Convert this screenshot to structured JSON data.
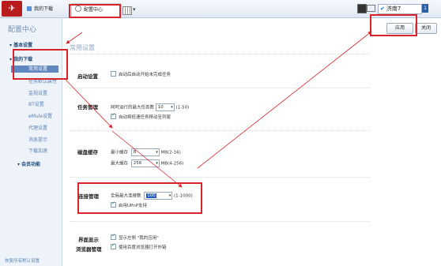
{
  "topbar": {
    "tabs": [
      {
        "label": "我的下载"
      },
      {
        "label": "配置中心"
      }
    ],
    "user": {
      "name": "济南7",
      "badge": "1"
    }
  },
  "sidebar": {
    "title": "配置中心",
    "items": [
      {
        "label": "基本设置",
        "kind": "header"
      },
      {
        "label": "我的下载",
        "kind": "header"
      },
      {
        "label": "常用设置",
        "kind": "sub",
        "selected": true
      },
      {
        "label": "任务默认属性",
        "kind": "sub"
      },
      {
        "label": "监视设置",
        "kind": "sub"
      },
      {
        "label": "BT设置",
        "kind": "sub"
      },
      {
        "label": "eMule设置",
        "kind": "sub"
      },
      {
        "label": "代理设置",
        "kind": "sub"
      },
      {
        "label": "消息提示",
        "kind": "sub"
      },
      {
        "label": "下载加速",
        "kind": "sub"
      },
      {
        "label": "会员功能",
        "kind": "header"
      }
    ],
    "restore": "恢复所有默认设置"
  },
  "toolbar": {
    "apply_label": "应用",
    "close_label": "关闭"
  },
  "main": {
    "section_title": "常用设置",
    "startup": {
      "label": "启动设置",
      "option": "启动后自动开始未完成任务",
      "checked": false
    },
    "task": {
      "label": "任务管理",
      "max_tasks_label": "同时运行的最大任务数",
      "max_tasks_value": "10",
      "max_tasks_range": "(1-50)",
      "auto_move_label": "自动将低速任务移动至列尾",
      "auto_move_checked": true
    },
    "cache": {
      "label": "磁盘缓存",
      "min_label": "最小缓存",
      "min_value": "8",
      "min_unit": "MB(2-16)",
      "max_label": "最大缓存",
      "max_value": "256",
      "max_unit": "MB(4-256)"
    },
    "connection": {
      "label": "连接管理",
      "max_conn_label": "全局最大连接数",
      "max_conn_value": "100",
      "max_conn_range": "(1-1000)",
      "upnp_label": "启用UPnP支持",
      "upnp_checked": true
    },
    "display": {
      "label": "界面显示",
      "option": "显示左侧 \"我的应用\"",
      "checked": true
    },
    "browser": {
      "label": "浏览器管理",
      "option": "使用百度浏览器打开外链",
      "checked": true
    }
  },
  "colors": {
    "annotation_red": "#d8232a",
    "sidebar_selected": "#5f86bd",
    "accent": "#1e5fc4"
  }
}
